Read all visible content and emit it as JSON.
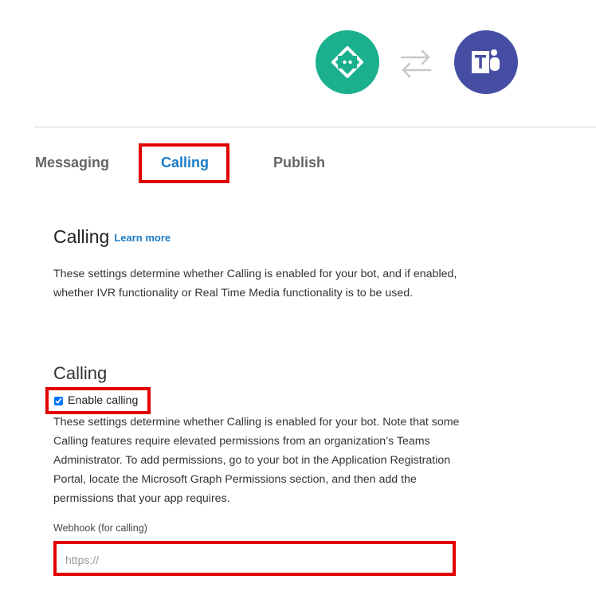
{
  "tabs": {
    "messaging": "Messaging",
    "calling": "Calling",
    "publish": "Publish"
  },
  "section": {
    "title": "Calling",
    "learn_more": "Learn more",
    "description": "These settings determine whether Calling is enabled for your bot, and if enabled, whether IVR functionality or Real Time Media functionality is to be used."
  },
  "calling": {
    "heading": "Calling",
    "enable_label": "Enable calling",
    "enable_checked": true,
    "description": "These settings determine whether Calling is enabled for your bot. Note that some Calling features require elevated permissions from an organization’s Teams Administrator. To add permissions, go to your bot in the Application Registration Portal, locate the Microsoft Graph Permissions section, and then add the permissions that your app requires."
  },
  "webhook": {
    "label": "Webhook (for calling)",
    "placeholder": "https://",
    "value": ""
  },
  "icons": {
    "bot": "bot-code-icon",
    "swap": "swap-arrows-icon",
    "teams": "microsoft-teams-icon"
  },
  "colors": {
    "bot_icon": "#1ab08e",
    "teams_icon": "#464ea4",
    "accent": "#1b7bc6",
    "highlight": "#e10000"
  }
}
